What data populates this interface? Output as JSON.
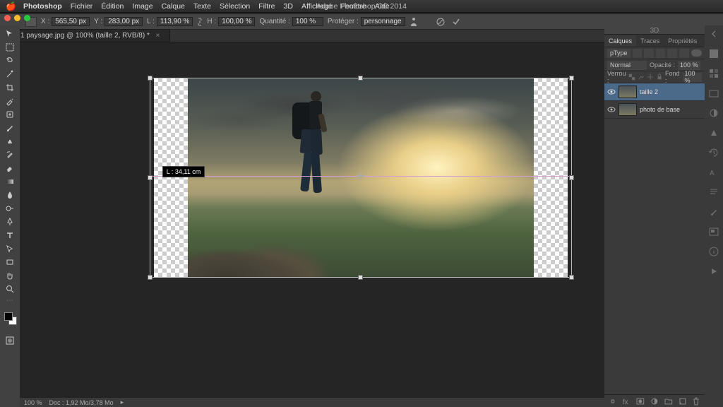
{
  "app": {
    "name": "Photoshop",
    "title": "Adobe Photoshop CC 2014"
  },
  "menu": {
    "items": [
      "Fichier",
      "Édition",
      "Image",
      "Calque",
      "Texte",
      "Sélection",
      "Filtre",
      "3D",
      "Affichage",
      "Fenêtre",
      "Aide"
    ]
  },
  "options": {
    "x_label": "X :",
    "x": "565,50 px",
    "y_label": "Y :",
    "y": "283,00 px",
    "w_label": "L :",
    "w": "113,90 %",
    "h_label": "H :",
    "h": "100,00 %",
    "qty_label": "Quantité :",
    "qty": "100 %",
    "protect_label": "Protéger :",
    "protect": "personnage",
    "3d_label": "3D"
  },
  "tab": {
    "label": "1 paysage.jpg @ 100% (taille 2, RVB/8) *"
  },
  "measure": {
    "label": "L : 34,11 cm"
  },
  "panel": {
    "tabs": [
      "Calques",
      "Traces",
      "Propriétés"
    ],
    "filter_label": "pType",
    "blend_mode": "Normal",
    "opacity_label": "Opacité :",
    "opacity": "100 %",
    "lock_label": "Verrou :",
    "fill_label": "Fond :",
    "fill": "100 %",
    "layers": [
      {
        "name": "taille 2",
        "selected": true
      },
      {
        "name": "photo de base",
        "selected": false
      }
    ]
  },
  "status": {
    "zoom": "100 %",
    "doc": "Doc : 1,92 Mo/3,78 Mo"
  }
}
